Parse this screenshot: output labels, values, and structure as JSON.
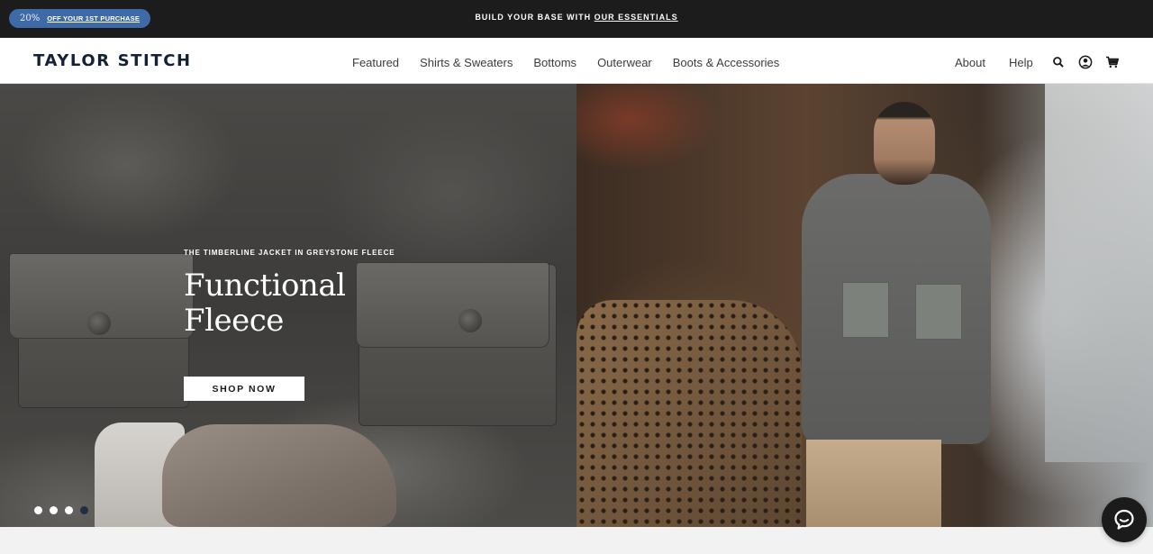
{
  "announcement": {
    "promo_percent": "20%",
    "promo_link": "OFF YOUR 1ST PURCHASE",
    "message_prefix": "BUILD YOUR BASE WITH",
    "message_link": "OUR ESSENTIALS"
  },
  "header": {
    "logo": "TAYLOR STITCH",
    "nav": [
      {
        "label": "Featured"
      },
      {
        "label": "Shirts & Sweaters"
      },
      {
        "label": "Bottoms"
      },
      {
        "label": "Outerwear"
      },
      {
        "label": "Boots & Accessories"
      }
    ],
    "secondary_nav": [
      {
        "label": "About"
      },
      {
        "label": "Help"
      }
    ],
    "icons": [
      "search-icon",
      "account-icon",
      "cart-icon"
    ]
  },
  "hero": {
    "eyebrow": "THE TIMBERLINE JACKET IN GREYSTONE FLEECE",
    "headline": "Functional Fleece",
    "cta_label": "SHOP NOW",
    "slides_count": 4,
    "active_slide": 4
  },
  "chat": {
    "icon": "chat-bubble-icon"
  },
  "colors": {
    "announcement_bg": "#1c1c1c",
    "promo_pill": "#3f6aa8",
    "logo": "#152235",
    "active_dot": "#1e2f46"
  }
}
